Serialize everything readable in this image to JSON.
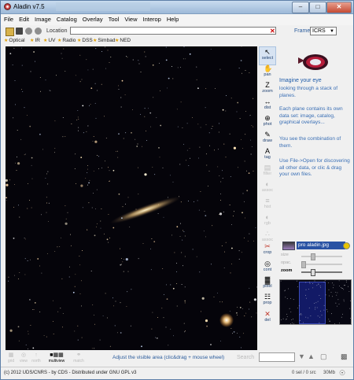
{
  "window": {
    "title": "Aladin v7.5"
  },
  "menu": [
    "File",
    "Edit",
    "Image",
    "Catalog",
    "Overlay",
    "Tool",
    "View",
    "Interop",
    "Help"
  ],
  "location": {
    "label": "Location",
    "value": ""
  },
  "frame": {
    "label": "Frame",
    "value": "ICRS"
  },
  "servers": [
    "Optical",
    "IR",
    "UV",
    "Radio",
    "DSS",
    "Simbad",
    "NED"
  ],
  "tools": [
    {
      "icon": "select-arrow-icon",
      "label": "select",
      "enabled": true,
      "selected": true
    },
    {
      "icon": "pan-hand-icon",
      "label": "pan",
      "enabled": true
    },
    {
      "icon": "zoom-icon",
      "label": "zoom",
      "enabled": true
    },
    {
      "icon": "dist-icon",
      "label": "dist",
      "enabled": true
    },
    {
      "icon": "phot-icon",
      "label": "phot",
      "enabled": true
    },
    {
      "icon": "draw-pencil-icon",
      "label": "draw",
      "enabled": true
    },
    {
      "icon": "tag-icon",
      "label": "tag",
      "enabled": true
    },
    {
      "icon": "filter-icon",
      "label": "filter",
      "enabled": false
    },
    {
      "icon": "rgb-icon",
      "label": "assoc",
      "enabled": false
    },
    {
      "icon": "cont-icon",
      "label": "hist",
      "enabled": false
    },
    {
      "icon": "rgb-icon",
      "label": "rgb",
      "enabled": false
    },
    {
      "icon": "assoc-icon",
      "label": "assoc",
      "enabled": false
    },
    {
      "icon": "crop-icon",
      "label": "crop",
      "enabled": true
    },
    {
      "icon": "contour-icon",
      "label": "cont",
      "enabled": true
    },
    {
      "icon": "pixel-icon",
      "label": "pixel",
      "enabled": true
    },
    {
      "icon": "prop-icon",
      "label": "prop",
      "enabled": true
    },
    {
      "icon": "del-icon",
      "label": "del",
      "enabled": true
    }
  ],
  "info": {
    "title": "Imagine your eye",
    "p1": "looking through a stack of planes.",
    "p2": "Each plane contains its own data set: image, catalog, graphical overlays...",
    "p3": "You see the combination of them.",
    "p4": "Use File->Open for discovering all other data, or clic & drag your own files."
  },
  "plane": {
    "name": "pro aladin.jpg"
  },
  "sliders": {
    "size": "size",
    "opacity": "opac.",
    "zoom": "zoom"
  },
  "bottom_tools": [
    "grid",
    "view",
    "north",
    "multiview",
    "match"
  ],
  "adjust_hint": "Adjust the visible area (clic&drag + mouse wheel)",
  "search": {
    "label": "Search"
  },
  "status": {
    "copyright": "(c) 2012 UDS/CNRS - by CDS - Distributed under GNU GPL v3",
    "selected": "0 sel / 0 src",
    "memory": "30Mb"
  },
  "colors": {
    "accent": "#2952a3",
    "brand": "#1d5aa8",
    "sky": "#05040a"
  }
}
